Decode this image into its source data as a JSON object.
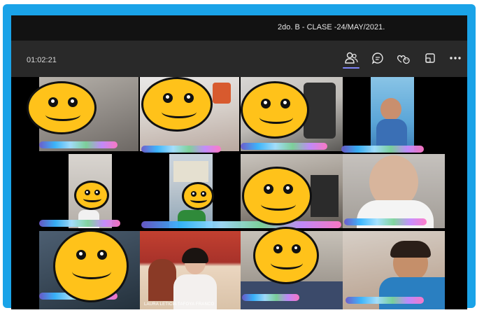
{
  "window": {
    "title": "2do. B - CLASE -24/MAY/2021."
  },
  "toolbar": {
    "timer": "01:02:21",
    "buttons": [
      {
        "name": "participants-icon",
        "active": true
      },
      {
        "name": "chat-icon",
        "active": false
      },
      {
        "name": "reactions-icon",
        "active": false
      },
      {
        "name": "share-tray-icon",
        "active": false
      },
      {
        "name": "more-options-icon",
        "active": false
      }
    ]
  },
  "participants": [
    {
      "caption": "LAURA LETICIA TAFOYA FRANCO",
      "video": "presenter"
    }
  ],
  "colors": {
    "frame": "#1aa3e8",
    "accent": "#7f85f5",
    "face": "#ffc21a",
    "toolbar": "#292929",
    "titlebar": "#121212"
  }
}
